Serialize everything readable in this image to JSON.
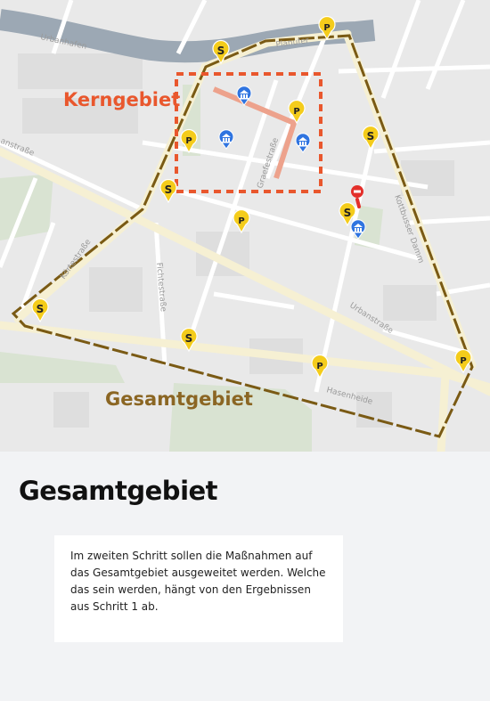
{
  "map": {
    "area_labels": {
      "core": "Kerngebiet",
      "total": "Gesamtgebiet"
    },
    "street_labels": {
      "urbanhafen": "Urbanhafen",
      "planufer": "Planufer",
      "urbanstrasse_west": "anstraße",
      "urbanstrasse_east": "Urbanstraße",
      "kottbusser_damm": "Kottbusser Damm",
      "graefestrasse": "Graefestraße",
      "koertestrasse": "Körtestraße",
      "fichtestrasse": "Fichtestraße",
      "hasenheide": "Hasenheide"
    },
    "colors": {
      "water": "#9ca8b4",
      "land": "#e9e9e9",
      "park": "#d9e3d2",
      "main_road": "#f6f0d3",
      "core_border": "#e9572d",
      "total_border": "#7a5a14",
      "marker": "#f4cc1b",
      "museum": "#2f74e0",
      "closure": "#e32f2a"
    },
    "markers": [
      {
        "type": "S",
        "label": "S"
      },
      {
        "type": "P",
        "label": "P"
      },
      {
        "type": "P",
        "label": "P"
      },
      {
        "type": "P",
        "label": "P"
      },
      {
        "type": "S",
        "label": "S"
      },
      {
        "type": "S",
        "label": "S"
      },
      {
        "type": "P",
        "label": "P"
      },
      {
        "type": "S",
        "label": "S"
      },
      {
        "type": "S",
        "label": "S"
      },
      {
        "type": "S",
        "label": "S"
      },
      {
        "type": "P",
        "label": "P"
      },
      {
        "type": "P",
        "label": "P"
      }
    ],
    "poi_icons": [
      "museum-icon",
      "museum-icon",
      "museum-icon",
      "museum-icon",
      "no-entry-icon"
    ]
  },
  "section": {
    "title": "Gesamtgebiet",
    "description": "Im zweiten Schritt sollen die Maßnahmen auf das Gesamtgebiet ausgeweitet werden. Welche das sein werden, hängt von den Ergebnissen aus Schritt 1 ab."
  }
}
